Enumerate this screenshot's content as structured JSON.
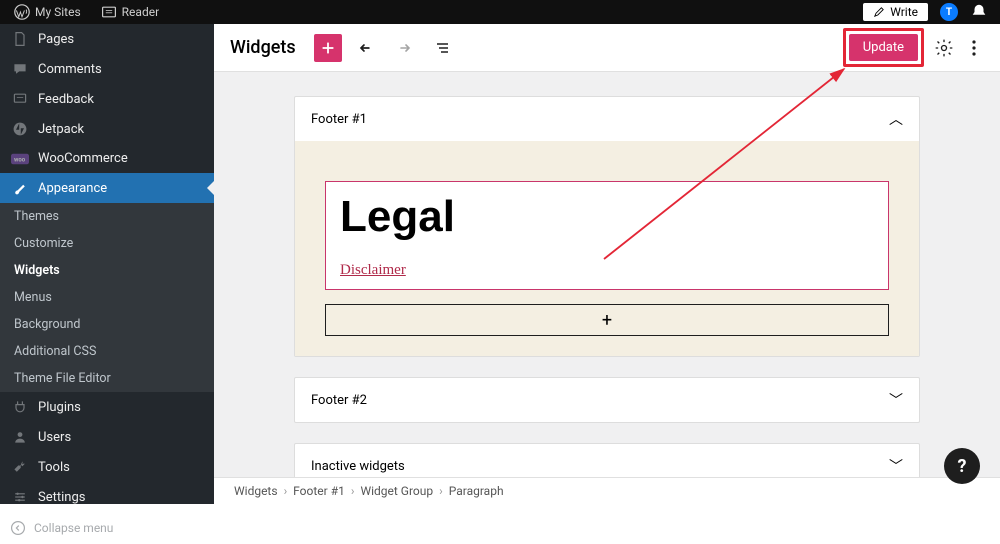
{
  "adminbar": {
    "my_sites": "My Sites",
    "reader": "Reader",
    "write": "Write",
    "avatar_initial": "T"
  },
  "sidebar": {
    "items": [
      {
        "key": "pages",
        "label": "Pages"
      },
      {
        "key": "comments",
        "label": "Comments"
      },
      {
        "key": "feedback",
        "label": "Feedback"
      },
      {
        "key": "jetpack",
        "label": "Jetpack"
      },
      {
        "key": "woocommerce",
        "label": "WooCommerce"
      },
      {
        "key": "appearance",
        "label": "Appearance"
      },
      {
        "key": "plugins",
        "label": "Plugins"
      },
      {
        "key": "users",
        "label": "Users"
      },
      {
        "key": "tools",
        "label": "Tools"
      },
      {
        "key": "settings",
        "label": "Settings"
      }
    ],
    "appearance_submenu": [
      "Themes",
      "Customize",
      "Widgets",
      "Menus",
      "Background",
      "Additional CSS",
      "Theme File Editor"
    ],
    "collapse": "Collapse menu"
  },
  "editor": {
    "title": "Widgets",
    "update": "Update",
    "areas": {
      "footer1": {
        "title": "Footer #1",
        "heading": "Legal",
        "link": "Disclaimer"
      },
      "footer2": {
        "title": "Footer #2"
      },
      "inactive": {
        "title": "Inactive widgets"
      }
    }
  },
  "breadcrumb": [
    "Widgets",
    "Footer #1",
    "Widget Group",
    "Paragraph"
  ]
}
